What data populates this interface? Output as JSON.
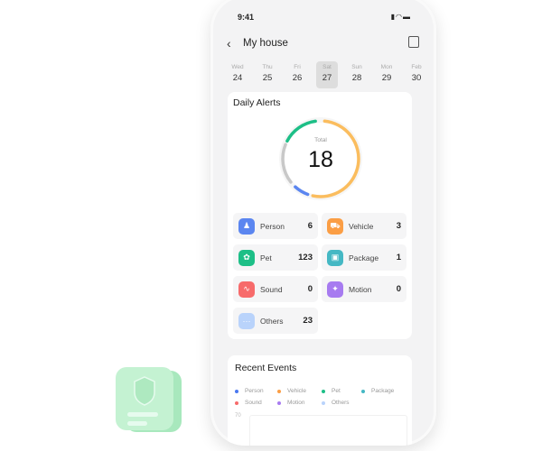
{
  "status": {
    "time": "9:41",
    "icons": [
      "signal-icon",
      "wifi-icon",
      "battery-icon"
    ]
  },
  "header": {
    "title": "My house",
    "back_icon": "chevron-left-icon",
    "action_icon": "device-scan-icon"
  },
  "days": [
    {
      "name": "Wed",
      "date": "24"
    },
    {
      "name": "Thu",
      "date": "25"
    },
    {
      "name": "Fri",
      "date": "26"
    },
    {
      "name": "Sat",
      "date": "27",
      "selected": true
    },
    {
      "name": "Sun",
      "date": "28"
    },
    {
      "name": "Mon",
      "date": "29"
    },
    {
      "name": "Feb",
      "date": "30"
    }
  ],
  "daily_alerts": {
    "title": "Daily Alerts",
    "total_label": "Total",
    "total": "18",
    "ring_colors": {
      "green": "#1dbf87",
      "orange": "#fbbd5e",
      "blue": "#5b86f0",
      "gray": "#c8c8c8"
    },
    "items": [
      {
        "label": "Person",
        "value": "6",
        "color": "#5b86f0",
        "icon": "person-icon"
      },
      {
        "label": "Vehicle",
        "value": "3",
        "color": "#fb9e45",
        "icon": "vehicle-icon"
      },
      {
        "label": "Pet",
        "value": "123",
        "color": "#1dbf87",
        "icon": "pet-icon"
      },
      {
        "label": "Package",
        "value": "1",
        "color": "#45b8c4",
        "icon": "package-icon"
      },
      {
        "label": "Sound",
        "value": "0",
        "color": "#f76b6b",
        "icon": "sound-icon"
      },
      {
        "label": "Motion",
        "value": "0",
        "color": "#a77bf0",
        "icon": "motion-icon"
      },
      {
        "label": "Others",
        "value": "23",
        "color": "#b9d3fb",
        "icon": "others-icon"
      }
    ]
  },
  "recent_events": {
    "title": "Recent Events",
    "axis_top": "70",
    "legend": [
      {
        "label": "Person",
        "color": "#4a78f0"
      },
      {
        "label": "Vehicle",
        "color": "#fb9e45"
      },
      {
        "label": "Pet",
        "color": "#1dbf87"
      },
      {
        "label": "Package",
        "color": "#45b8c4"
      },
      {
        "label": "Sound",
        "color": "#f76b6b"
      },
      {
        "label": "Motion",
        "color": "#a77bf0"
      },
      {
        "label": "Others",
        "color": "#b9d3fb"
      }
    ]
  }
}
